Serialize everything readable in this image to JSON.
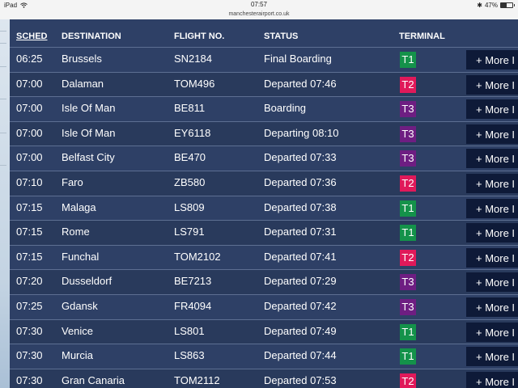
{
  "status_bar": {
    "device": "iPad",
    "time": "07:57",
    "battery": "47%"
  },
  "url": "manchesterairport.co.uk",
  "colors": {
    "T1": "#14924a",
    "T2": "#e0195a",
    "T3": "#6e1e82"
  },
  "header": {
    "sched": "SCHED",
    "destination": "DESTINATION",
    "flight": "FLIGHT NO.",
    "status": "STATUS",
    "terminal": "TERMINAL"
  },
  "more_label": "+ More I",
  "flights": [
    {
      "sched": "06:25",
      "dest": "Brussels",
      "flight": "SN2184",
      "status": "Final Boarding",
      "terminal": "T1"
    },
    {
      "sched": "07:00",
      "dest": "Dalaman",
      "flight": "TOM496",
      "status": "Departed 07:46",
      "terminal": "T2"
    },
    {
      "sched": "07:00",
      "dest": "Isle Of Man",
      "flight": "BE811",
      "status": "Boarding",
      "terminal": "T3"
    },
    {
      "sched": "07:00",
      "dest": "Isle Of Man",
      "flight": "EY6118",
      "status": "Departing 08:10",
      "terminal": "T3"
    },
    {
      "sched": "07:00",
      "dest": "Belfast City",
      "flight": "BE470",
      "status": "Departed 07:33",
      "terminal": "T3"
    },
    {
      "sched": "07:10",
      "dest": "Faro",
      "flight": "ZB580",
      "status": "Departed 07:36",
      "terminal": "T2"
    },
    {
      "sched": "07:15",
      "dest": "Malaga",
      "flight": "LS809",
      "status": "Departed 07:38",
      "terminal": "T1"
    },
    {
      "sched": "07:15",
      "dest": "Rome",
      "flight": "LS791",
      "status": "Departed 07:31",
      "terminal": "T1"
    },
    {
      "sched": "07:15",
      "dest": "Funchal",
      "flight": "TOM2102",
      "status": "Departed 07:41",
      "terminal": "T2"
    },
    {
      "sched": "07:20",
      "dest": "Dusseldorf",
      "flight": "BE7213",
      "status": "Departed 07:29",
      "terminal": "T3"
    },
    {
      "sched": "07:25",
      "dest": "Gdansk",
      "flight": "FR4094",
      "status": "Departed 07:42",
      "terminal": "T3"
    },
    {
      "sched": "07:30",
      "dest": "Venice",
      "flight": "LS801",
      "status": "Departed 07:49",
      "terminal": "T1"
    },
    {
      "sched": "07:30",
      "dest": "Murcia",
      "flight": "LS863",
      "status": "Departed 07:44",
      "terminal": "T1"
    },
    {
      "sched": "07:30",
      "dest": "Gran Canaria",
      "flight": "TOM2112",
      "status": "Departed 07:53",
      "terminal": "T2"
    }
  ]
}
